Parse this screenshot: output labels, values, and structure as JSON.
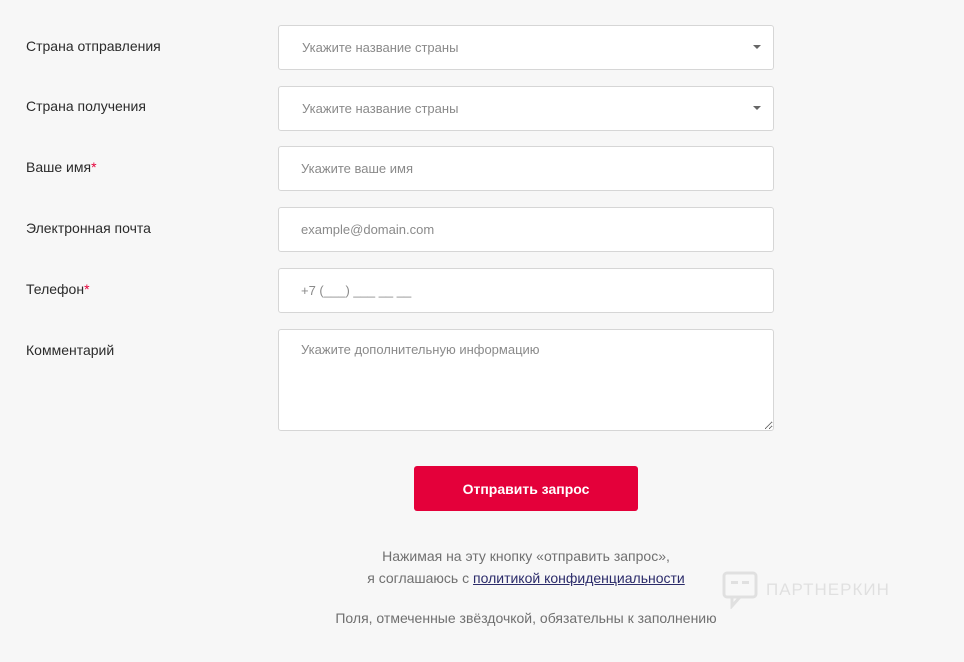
{
  "fields": {
    "from_country": {
      "label": "Страна отправления",
      "placeholder": "Укажите название страны"
    },
    "to_country": {
      "label": "Страна получения",
      "placeholder": "Укажите название страны"
    },
    "name": {
      "label": "Ваше имя",
      "required_mark": "*",
      "placeholder": "Укажите ваше имя"
    },
    "email": {
      "label": "Электронная почта",
      "placeholder": "example@domain.com"
    },
    "phone": {
      "label": "Телефон",
      "required_mark": "*",
      "placeholder": "+7 (___) ___ __ __"
    },
    "comment": {
      "label": "Комментарий",
      "placeholder": "Укажите дополнительную информацию"
    }
  },
  "submit_label": "Отправить запрос",
  "consent": {
    "line1": "Нажимая на эту кнопку «отправить запрос»,",
    "line2_prefix": "я соглашаюсь с ",
    "link": "политикой конфиденциальности"
  },
  "required_note": "Поля, отмеченные звёздочкой, обязательны к заполнению",
  "watermark": {
    "icon": "chat-bubble-icon"
  },
  "colors": {
    "accent": "#e4003a",
    "link": "#2b2b6a",
    "background": "#f7f7f7"
  }
}
